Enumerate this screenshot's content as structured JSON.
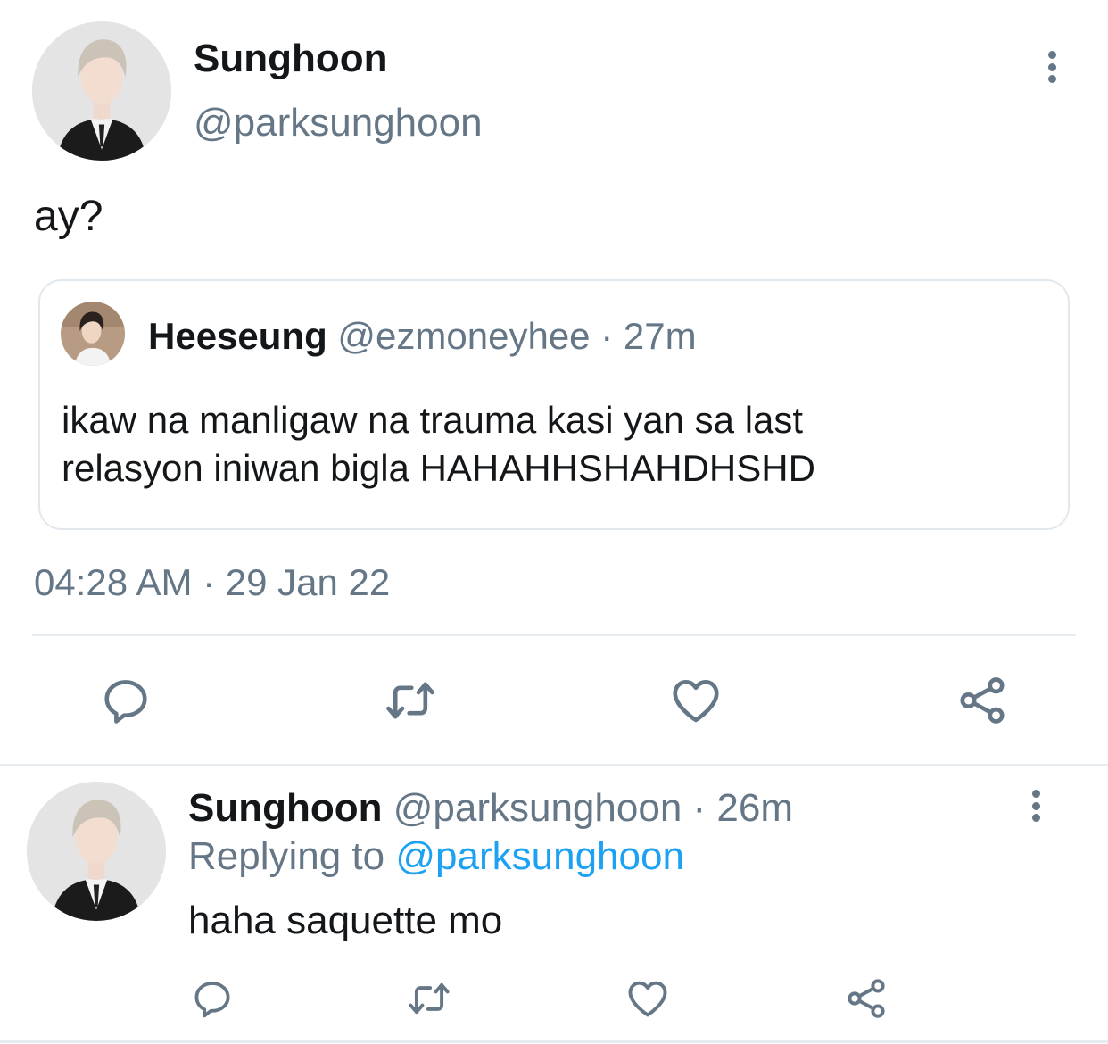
{
  "main_tweet": {
    "display_name": "Sunghoon",
    "handle": "@parksunghoon",
    "text": "ay?",
    "timestamp": "04:28 AM · 29 Jan 22",
    "more_icon": "more-vertical-icon"
  },
  "quoted_tweet": {
    "display_name": "Heeseung",
    "handle": "@ezmoneyhee",
    "separator": "·",
    "time": "27m",
    "text_line1": "ikaw na manligaw na trauma kasi yan sa last",
    "text_line2": "relasyon iniwan bigla HAHAHHSHAHDHSHD"
  },
  "actions": {
    "reply_icon": "reply-icon",
    "retweet_icon": "retweet-icon",
    "like_icon": "heart-icon",
    "share_icon": "share-icon"
  },
  "reply_tweet": {
    "display_name": "Sunghoon",
    "handle": "@parksunghoon",
    "separator": "·",
    "time": "26m",
    "replying_prefix": "Replying to",
    "replying_handle": "@parksunghoon",
    "text": "haha saquette mo"
  },
  "colors": {
    "text": "#14171a",
    "muted": "#657786",
    "link": "#1da1f2",
    "divider": "#e6ecf0"
  }
}
